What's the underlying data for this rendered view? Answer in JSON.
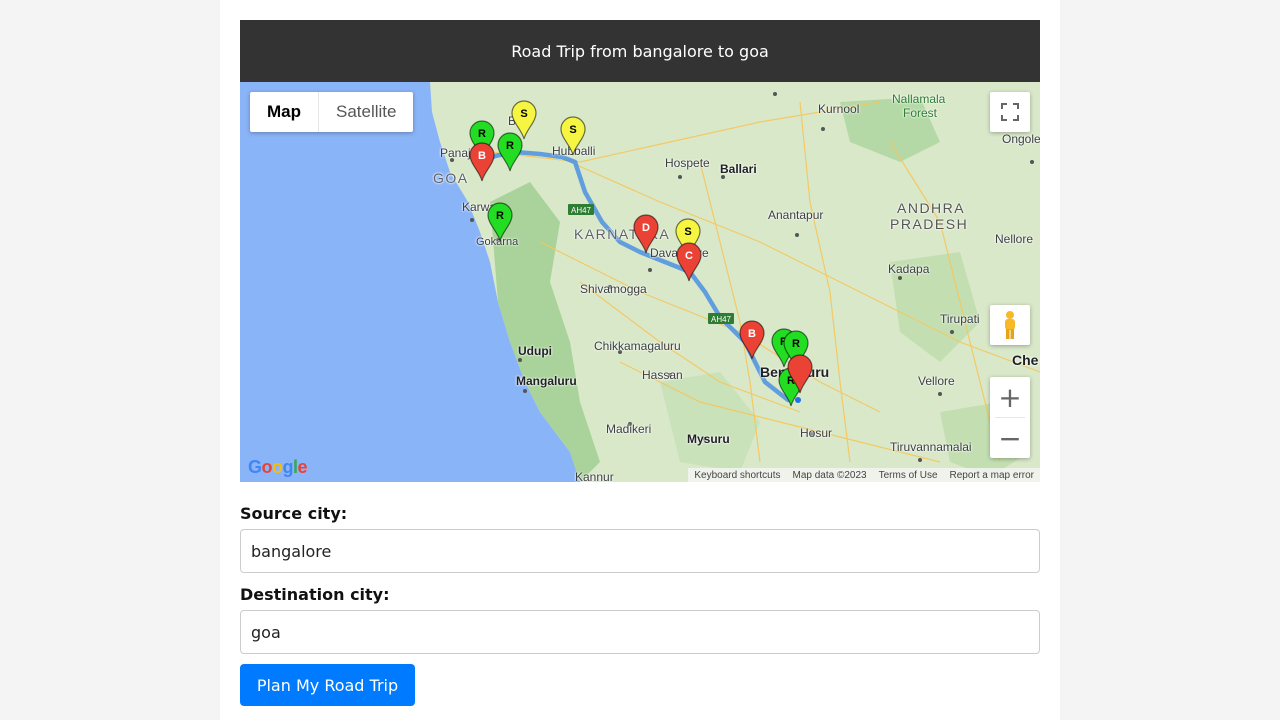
{
  "header": {
    "title": "Road Trip from bangalore to goa"
  },
  "map": {
    "type_controls": {
      "map_label": "Map",
      "satellite_label": "Satellite",
      "selected": "Map"
    },
    "zoom_in_symbol": "+",
    "zoom_out_symbol": "−",
    "attribution": {
      "keyboard": "Keyboard shortcuts",
      "data": "Map data ©2023",
      "terms": "Terms of Use",
      "report": "Report a map error"
    },
    "logo": {
      "text": "Google"
    },
    "region_labels": {
      "goa": "GOA",
      "karnataka": "KARNATAKA",
      "andhra": "ANDHRA",
      "pradesh": "PRADESH",
      "nallamala": "Nallamala",
      "forest": "Forest"
    },
    "city_labels": {
      "belagavi": "Bel",
      "hubballi": "Hubballi",
      "hospete": "Hospete",
      "ballari": "Ballari",
      "kurnool": "Kurnool",
      "ongole": "Ongole",
      "panaji": "Panaji",
      "karwar": "Karwar",
      "gokarna": "Gokarna",
      "anantapur": "Anantapur",
      "davangere": "Davangere",
      "nellore": "Nellore",
      "kadapa": "Kadapa",
      "shivamogga": "Shivamogga",
      "tirupati": "Tirupati",
      "chikkamagaluru": "Chikkamagaluru",
      "udupi": "Udupi",
      "chennai": "Che",
      "bengaluru": "Bengaluru",
      "mangaluru": "Mangaluru",
      "hassan": "Hassan",
      "vellore": "Vellore",
      "hosur": "Hosur",
      "madikeri": "Madikeri",
      "mysuru": "Mysuru",
      "tiruvannamalai": "Tiruvannamalai",
      "kannur": "Kannur"
    },
    "highways": [
      "AH47",
      "AH47"
    ],
    "route_markers": [
      {
        "letter": "B",
        "color": "#ea4335"
      },
      {
        "letter": "C",
        "color": "#ea4335"
      },
      {
        "letter": "D",
        "color": "#ea4335"
      }
    ],
    "poi_markers": [
      {
        "letter": "S",
        "color": "#f5f542"
      },
      {
        "letter": "S",
        "color": "#f5f542"
      },
      {
        "letter": "S",
        "color": "#f5f542"
      },
      {
        "letter": "R",
        "color": "#22dd22"
      },
      {
        "letter": "R",
        "color": "#22dd22"
      },
      {
        "letter": "R",
        "color": "#22dd22"
      },
      {
        "letter": "R",
        "color": "#22dd22"
      }
    ]
  },
  "form": {
    "source_label": "Source city:",
    "source_value": "bangalore",
    "destination_label": "Destination city:",
    "destination_value": "goa",
    "submit_label": "Plan My Road Trip"
  },
  "colors": {
    "header_bg": "#333333",
    "button_bg": "#007bff",
    "route": "#4a90e2",
    "sea": "#8ab4f8",
    "land": "#cde3c5"
  }
}
